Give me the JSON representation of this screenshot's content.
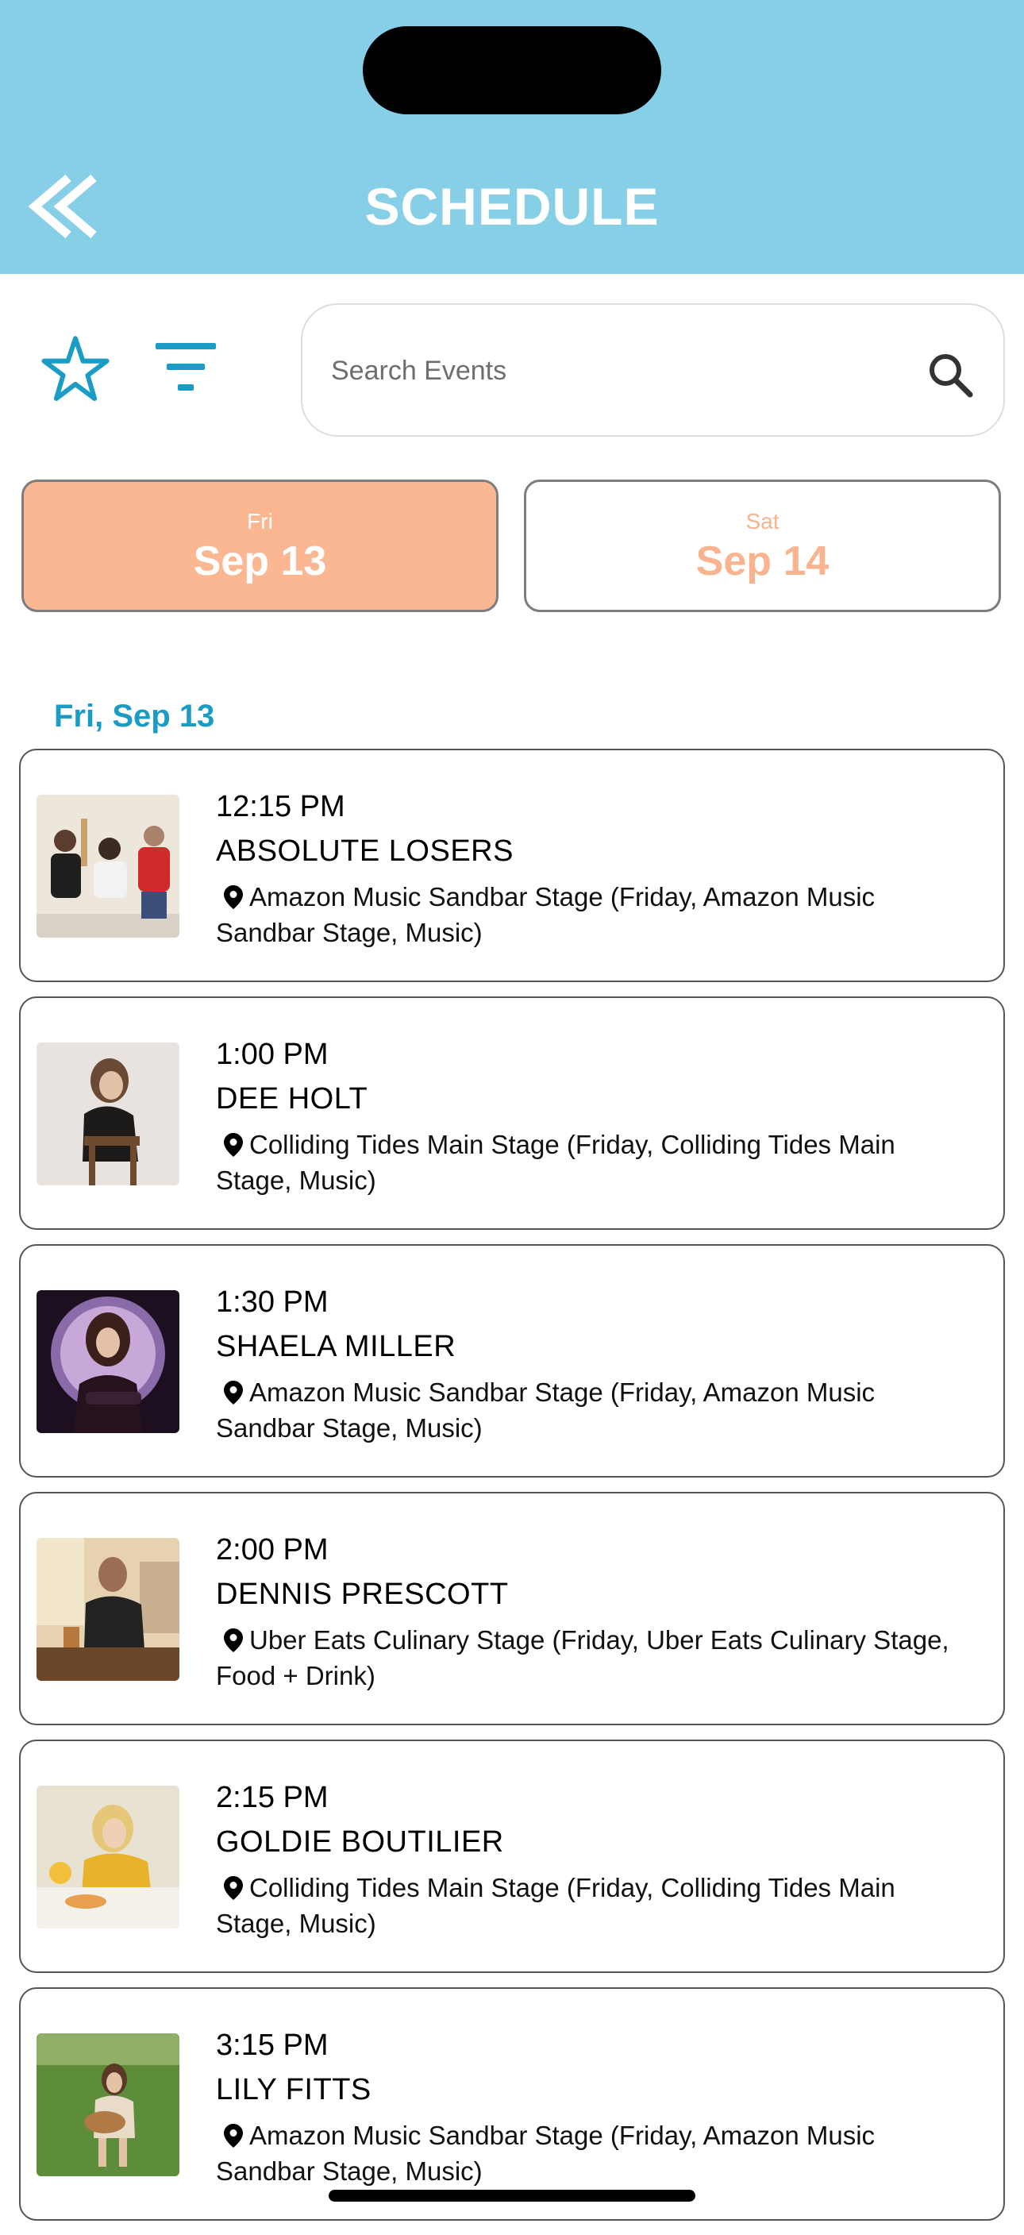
{
  "header": {
    "title": "SCHEDULE",
    "background_color": "#87cfe6",
    "back_icon": "double-chevron-left-icon"
  },
  "toolbar": {
    "favorites_icon": "star-outline-icon",
    "filter_icon": "filter-lines-icon",
    "search": {
      "placeholder": "Search Events",
      "value": "",
      "icon": "search-icon"
    }
  },
  "days": [
    {
      "dow": "Fri",
      "date": "Sep 13",
      "selected": true,
      "color": "#fbb792"
    },
    {
      "dow": "Sat",
      "date": "Sep 14",
      "selected": false,
      "color": "#f7b48e"
    }
  ],
  "section_heading": "Fri, Sep 13",
  "events": [
    {
      "time": "12:15 PM",
      "name": "ABSOLUTE LOSERS",
      "location": "Amazon Music Sandbar Stage (Friday, Amazon Music Sandbar Stage, Music)"
    },
    {
      "time": "1:00 PM",
      "name": "DEE HOLT",
      "location": "Colliding Tides Main Stage (Friday, Colliding Tides Main Stage, Music)"
    },
    {
      "time": "1:30 PM",
      "name": "SHAELA MILLER",
      "location": "Amazon Music Sandbar Stage (Friday, Amazon Music Sandbar Stage, Music)"
    },
    {
      "time": "2:00 PM",
      "name": "DENNIS PRESCOTT",
      "location": "Uber Eats Culinary Stage (Friday, Uber Eats Culinary Stage, Food + Drink)"
    },
    {
      "time": "2:15 PM",
      "name": "GOLDIE BOUTILIER",
      "location": "Colliding Tides Main Stage (Friday, Colliding Tides Main Stage, Music)"
    },
    {
      "time": "3:15 PM",
      "name": "LILY FITTS",
      "location": "Amazon Music Sandbar Stage (Friday, Amazon Music Sandbar Stage, Music)"
    }
  ],
  "accent_color": "#1b9cc4"
}
